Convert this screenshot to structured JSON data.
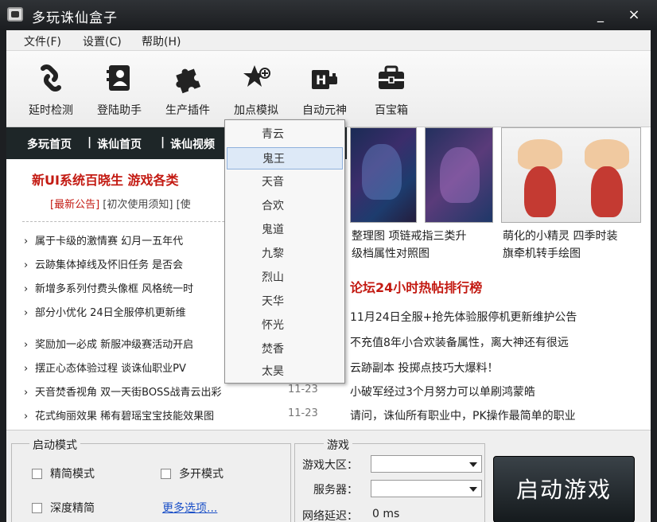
{
  "window": {
    "title": "多玩诛仙盒子",
    "minimize": "_",
    "close": "×"
  },
  "menu": [
    "文件(F)",
    "设置(C)",
    "帮助(H)"
  ],
  "toolbar": [
    {
      "label": "延时检测",
      "icon": "chain-link-icon"
    },
    {
      "label": "登陆助手",
      "icon": "contact-card-icon"
    },
    {
      "label": "生产插件",
      "icon": "puzzle-piece-icon"
    },
    {
      "label": "加点模拟",
      "icon": "star-plus-icon"
    },
    {
      "label": "自动元神",
      "icon": "h-chip-icon"
    },
    {
      "label": "百宝箱",
      "icon": "toolbox-icon"
    }
  ],
  "nav": [
    "多玩首页",
    "|",
    "诛仙首页",
    "|",
    "诛仙视频"
  ],
  "notice": "新UI系统百晓生  游戏各类",
  "subnav": {
    "hot": "[最新公告]",
    "rest": "[初次使用须知] [使"
  },
  "news": [
    {
      "text": "属于卡级的激情赛 幻月一五年代",
      "date": ""
    },
    {
      "text": "云跡集体掉线及怀旧任务 是否会",
      "date": ""
    },
    {
      "text": "新增多系列付费头像框 风格统一时",
      "date": ""
    },
    {
      "text": "部分小优化 24日全服停机更新维",
      "date": ""
    },
    {
      "text": "奖励加一必成 新服冲级赛活动开启",
      "date": ""
    },
    {
      "text": "摆正心态体验过程 谈诛仙职业PV",
      "date": ""
    },
    {
      "text": "天音焚香视角 双一天街BOSS战青云出彩",
      "date": "11-23"
    },
    {
      "text": "花式绚丽效果 稀有碧瑶宝宝技能效果图",
      "date": "11-23"
    }
  ],
  "captions": {
    "left": [
      "整理图 项链戒指三类升",
      "级档属性对照图"
    ],
    "right": [
      "萌化的小精灵 四季时装",
      "旗牵机转手绘图"
    ]
  },
  "rank_title": "论坛24小时热帖排行榜",
  "rank": [
    "11月24日全服+抢先体验服停机更新维护公告",
    "不充值8年小合欢装备属性，离大神还有很远",
    "云跡副本 投掷点技巧大爆料！",
    "小破军经过3个月努力可以单刷鸿蒙皓",
    "请问，诛仙所有职业中，PK操作最简单的职业"
  ],
  "dropdown": {
    "items": [
      "青云",
      "鬼王",
      "天音",
      "合欢",
      "鬼道",
      "九黎",
      "烈山",
      "天华",
      "怀光",
      "焚香",
      "太昊"
    ],
    "selected_index": 1
  },
  "bottom": {
    "mode_group": "启动模式",
    "checkboxes": [
      "精简模式",
      "多开模式",
      "深度精简"
    ],
    "more_link": "更多选项...",
    "game_group": "游戏",
    "region_label": "游戏大区：",
    "server_label": "服务器：",
    "latency_label": "网络延迟：",
    "latency_value": "0 ms",
    "launch_button": "启动游戏"
  },
  "colors": {
    "accent_red": "#c31a12",
    "nav_bg": "#1e2628",
    "link_blue": "#1a4fc7"
  }
}
